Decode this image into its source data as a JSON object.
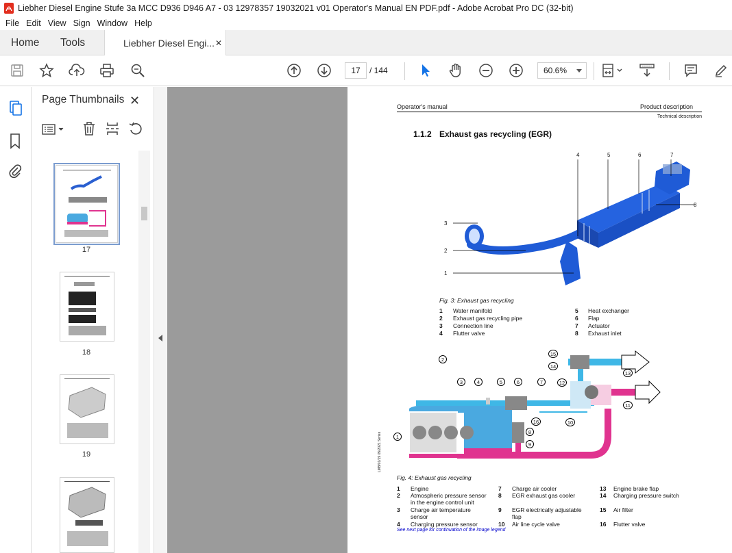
{
  "window": {
    "title": "Liebher Diesel Engine Stufe 3a MCC D936 D946 A7 - 03 12978357 19032021 v01 Operator's Manual EN PDF.pdf - Adobe Acrobat Pro DC (32-bit)"
  },
  "menu": [
    "File",
    "Edit",
    "View",
    "Sign",
    "Window",
    "Help"
  ],
  "tabs": {
    "home": "Home",
    "tools": "Tools",
    "document": "Liebher Diesel Engi...",
    "close": "✕"
  },
  "toolbar": {
    "page_current": "17",
    "page_total": "/ 144",
    "zoom": "60.6%",
    "icons": [
      "save-icon",
      "bookmark-star-icon",
      "upload-icon",
      "print-icon",
      "zoom-search-icon",
      "page-up-icon",
      "page-down-icon",
      "select-arrow-icon",
      "hand-icon",
      "zoom-out-icon",
      "zoom-in-icon",
      "fit-page-icon",
      "scroll-mode-icon",
      "comment-icon",
      "pen-icon"
    ]
  },
  "sidebar": {
    "title": "Page Thumbnails",
    "close": "✕",
    "thumbs": [
      {
        "label": "17"
      },
      {
        "label": "18"
      },
      {
        "label": "19"
      },
      {
        "label": ""
      }
    ]
  },
  "doc": {
    "header_left": "Operator's manual",
    "header_right": "Product description",
    "header_sub": "Technical description",
    "section_no": "1.1.2",
    "section_title": "Exhaust gas recycling (EGR)",
    "fig3": {
      "caption": "Fig. 3: Exhaust gas recycling",
      "callouts": [
        "4",
        "5",
        "6",
        "7",
        "8",
        "3",
        "2",
        "1"
      ],
      "legend": [
        {
          "n": "1",
          "t": "Water manifold"
        },
        {
          "n": "2",
          "t": "Exhaust gas recycling pipe"
        },
        {
          "n": "3",
          "t": "Connection line"
        },
        {
          "n": "4",
          "t": "Flutter valve"
        },
        {
          "n": "5",
          "t": "Heat exchanger"
        },
        {
          "n": "6",
          "t": "Flap"
        },
        {
          "n": "7",
          "t": "Actuator"
        },
        {
          "n": "8",
          "t": "Exhaust inlet"
        }
      ]
    },
    "fig4": {
      "caption": "Fig. 4: Exhaust gas recycling",
      "callouts": [
        "1",
        "2",
        "3",
        "4",
        "5",
        "6",
        "7",
        "8",
        "9",
        "10",
        "11",
        "12",
        "13",
        "14",
        "15",
        "16"
      ],
      "legend": [
        {
          "n": "1",
          "t": "Engine"
        },
        {
          "n": "2",
          "t": "Atmospheric pressure sensor in the engine control unit"
        },
        {
          "n": "3",
          "t": "Charge air temperature sensor"
        },
        {
          "n": "4",
          "t": "Charging pressure sensor"
        },
        {
          "n": "7",
          "t": "Charge air cooler"
        },
        {
          "n": "8",
          "t": "EGR exhaust gas cooler"
        },
        {
          "n": "9",
          "t": "EGR electrically adjustable flap"
        },
        {
          "n": "10",
          "t": "Air line cycle valve"
        },
        {
          "n": "13",
          "t": "Engine brake flap"
        },
        {
          "n": "14",
          "t": "Charging pressure switch"
        },
        {
          "n": "15",
          "t": "Air filter"
        },
        {
          "n": "16",
          "t": "Flutter valve"
        }
      ],
      "note": "See next page for continuation of the image legend",
      "margin_code": "LMB/01/19 05/2021 Series"
    },
    "colors": {
      "blue_part": "#1f5bd6",
      "air_blue": "#3fb7e6",
      "exhaust_pink": "#e0338f",
      "engine_blue": "#4aa9e0"
    }
  }
}
